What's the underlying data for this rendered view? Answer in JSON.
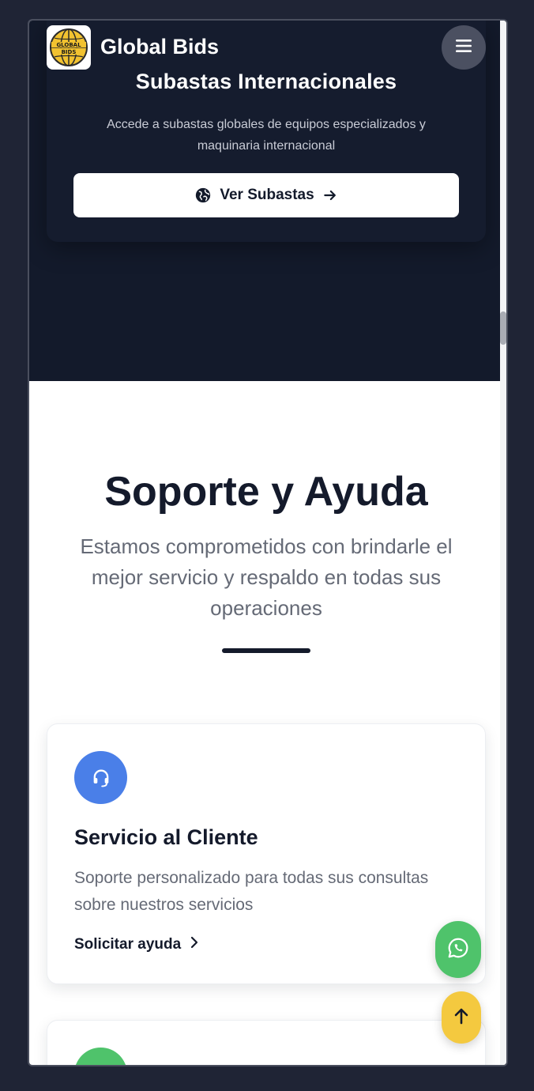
{
  "header": {
    "brand": "Global Bids",
    "logo_text_top": "GLOBAL",
    "logo_text_bottom": "BIDS"
  },
  "hero": {
    "title": "Subastas Internacionales",
    "description": "Accede a subastas globales de equipos especializados y maquinaria internacional",
    "button_label": "Ver Subastas"
  },
  "support": {
    "title": "Soporte y Ayuda",
    "description": "Estamos comprometidos con brindarle el mejor servicio y respaldo en todas sus operaciones",
    "cards": [
      {
        "icon": "headset-icon",
        "title": "Servicio al Cliente",
        "description": "Soporte personalizado para todas sus consultas sobre nuestros servicios",
        "link": "Solicitar ayuda",
        "color": "#4a7fe8"
      },
      {
        "icon": "check-icon",
        "color": "#4fc36b"
      }
    ]
  },
  "floating": {
    "whatsapp_icon": "whatsapp-icon",
    "scroll_top_icon": "arrow-up-icon"
  },
  "colors": {
    "page_bg": "#1f2435",
    "hero_bg": "#131a2b",
    "accent_yellow": "#f4c93f",
    "accent_green": "#4fc36b",
    "accent_blue": "#4a7fe8"
  }
}
